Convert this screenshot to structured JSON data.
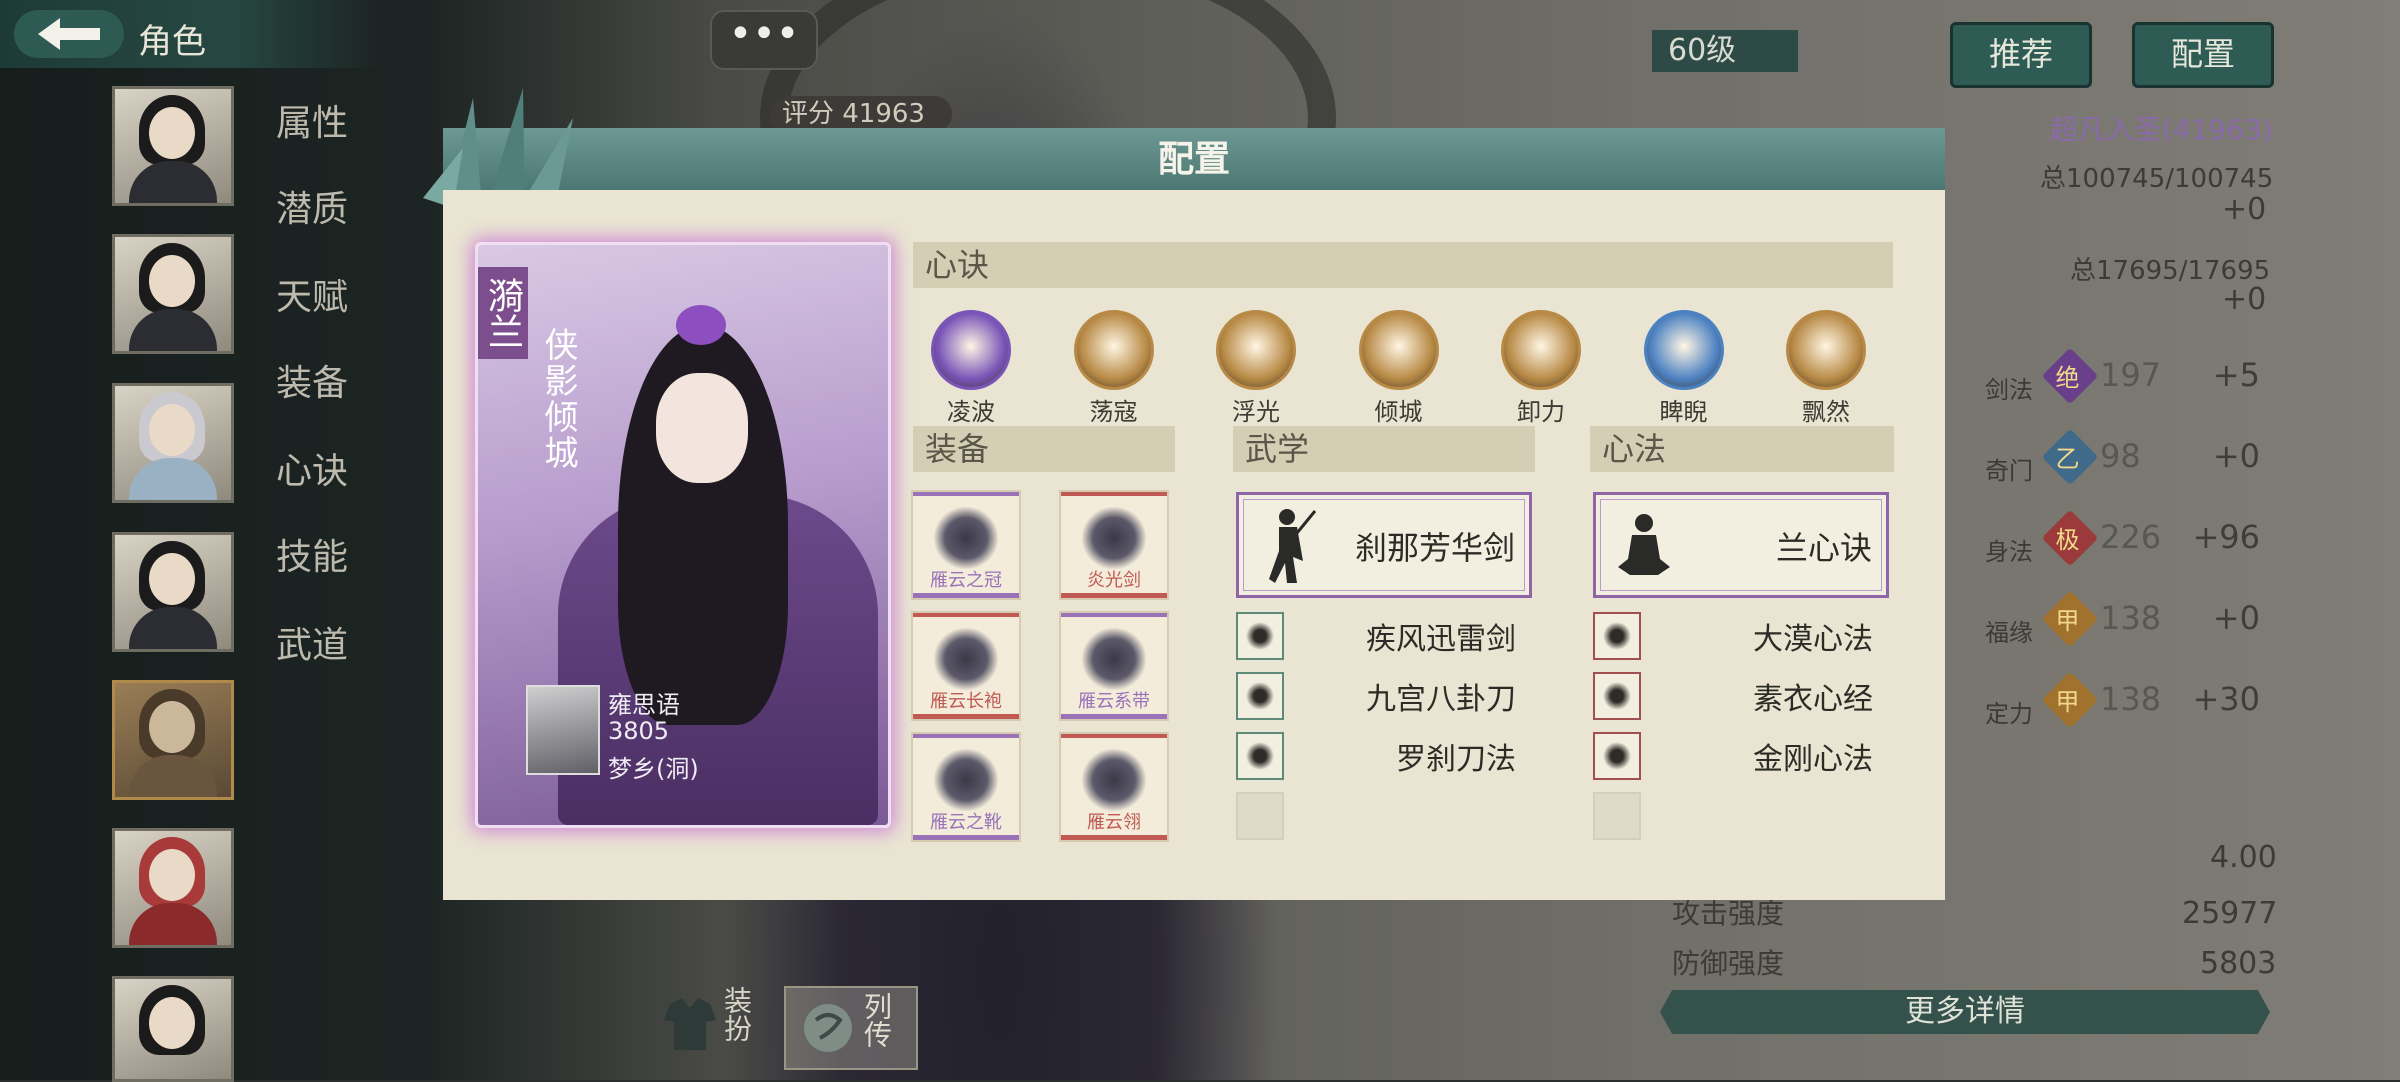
{
  "header": {
    "title": "角色"
  },
  "side_menu": [
    "属性",
    "潜质",
    "天赋",
    "装备",
    "心诀",
    "技能",
    "武道"
  ],
  "top_misc": {
    "bubble": "•••",
    "score": "评分 41963"
  },
  "right_panel": {
    "level": "60级",
    "btn_recommend": "推荐",
    "btn_config": "配置",
    "rank": "超凡入圣(41963)",
    "total1": "总100745/100745",
    "plus1": "+0",
    "total2": "总17695/17695",
    "plus2": "+0",
    "stats": [
      {
        "label": "剑法",
        "grade": "绝",
        "value": "197",
        "delta": "+5",
        "color": "#6a3f8a"
      },
      {
        "label": "奇门",
        "grade": "乙",
        "value": "98",
        "delta": "+0",
        "color": "#3f6a8a"
      },
      {
        "label": "身法",
        "grade": "极",
        "value": "226",
        "delta": "+96",
        "color": "#9a3a3a"
      },
      {
        "label": "福缘",
        "grade": "甲",
        "value": "138",
        "delta": "+0",
        "color": "#a0722e"
      },
      {
        "label": "定力",
        "grade": "甲",
        "value": "138",
        "delta": "+30",
        "color": "#a0722e"
      }
    ],
    "rows": [
      {
        "label": "",
        "value": "4.00"
      },
      {
        "label": "攻击强度",
        "value": "25977"
      },
      {
        "label": "防御强度",
        "value": "5803"
      }
    ],
    "more": "更多详情"
  },
  "bottom": {
    "dress": "装扮",
    "biography": "列传"
  },
  "modal": {
    "title": "配置",
    "card": {
      "name": "漪兰",
      "subtitle": "侠影倾城",
      "player_name": "雍思语",
      "player_power": "3805",
      "player_server": "梦乡(洞)"
    },
    "xinjue": {
      "heading": "心诀",
      "items": [
        {
          "name": "凌波",
          "color": "#7a55b8"
        },
        {
          "name": "荡寇",
          "color": "#b88a46"
        },
        {
          "name": "浮光",
          "color": "#b88a46"
        },
        {
          "name": "倾城",
          "color": "#b88a46"
        },
        {
          "name": "卸力",
          "color": "#b88a46"
        },
        {
          "name": "睥睨",
          "color": "#4d82c2"
        },
        {
          "name": "飘然",
          "color": "#b88a46"
        }
      ]
    },
    "equipment": {
      "heading": "装备",
      "items": [
        {
          "name": "雁云之冠",
          "color": "#9a72b8"
        },
        {
          "name": "炎光剑",
          "color": "#c05a52"
        },
        {
          "name": "雁云长袍",
          "color": "#c05a52"
        },
        {
          "name": "雁云系带",
          "color": "#9a72b8"
        },
        {
          "name": "雁云之靴",
          "color": "#9a72b8"
        },
        {
          "name": "雁云翎",
          "color": "#c05a52"
        }
      ]
    },
    "wuxue": {
      "heading": "武学",
      "main": "刹那芳华剑",
      "items": [
        "疾风迅雷剑",
        "九宫八卦刀",
        "罗刹刀法"
      ]
    },
    "xinfa": {
      "heading": "心法",
      "main": "兰心诀",
      "items": [
        "大漠心法",
        "素衣心经",
        "金刚心法"
      ]
    }
  }
}
